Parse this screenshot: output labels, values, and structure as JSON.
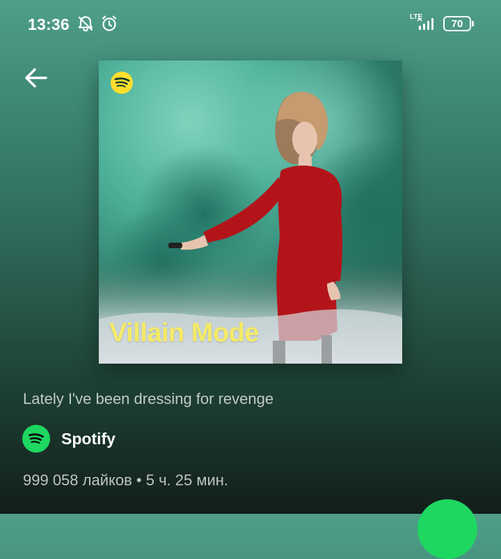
{
  "status_bar": {
    "time": "13:36",
    "network": "LTE",
    "battery": "70",
    "icons": [
      "bell-off-icon",
      "alarm-icon",
      "signal-icon",
      "battery-icon"
    ]
  },
  "nav": {
    "back_icon": "arrow-left-icon"
  },
  "playlist": {
    "cover_title": "Villain Mode",
    "cover_logo": "spotify-logo-icon",
    "description": "Lately I've been dressing for revenge",
    "owner": "Spotify",
    "meta": "999 058 лайков • 5 ч. 25 мин."
  },
  "colors": {
    "accent": "#1ed760",
    "cover_text": "#f4ea68",
    "dress": "#b3141a",
    "smoke": "#2f8f7b"
  }
}
